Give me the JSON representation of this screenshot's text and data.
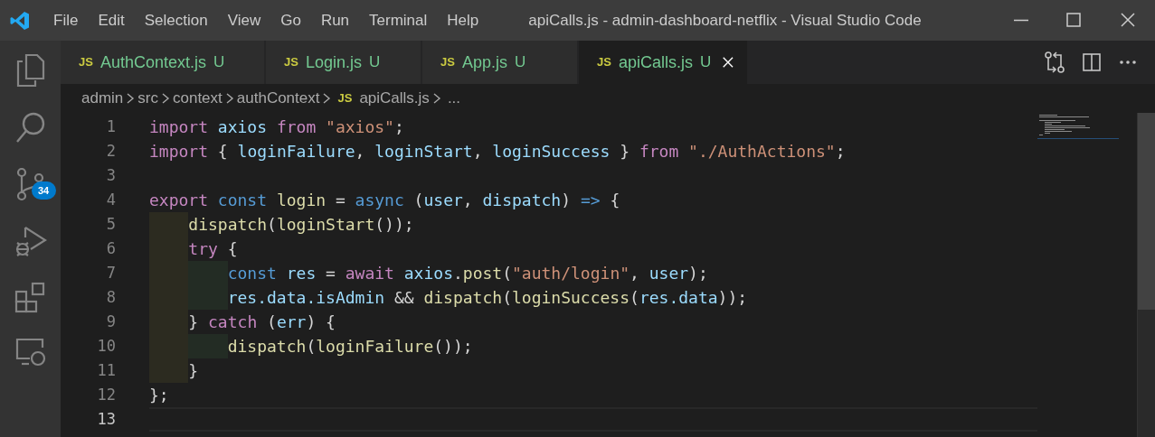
{
  "menu": [
    "File",
    "Edit",
    "Selection",
    "View",
    "Go",
    "Run",
    "Terminal",
    "Help"
  ],
  "window": {
    "title": "apiCalls.js - admin-dashboard-netflix - Visual Studio Code"
  },
  "activity_bar": {
    "source_control_badge": "34"
  },
  "tabs": [
    {
      "icon": "JS",
      "label": "AuthContext.js",
      "status": "U",
      "selected": false
    },
    {
      "icon": "JS",
      "label": "Login.js",
      "status": "U",
      "selected": false
    },
    {
      "icon": "JS",
      "label": "App.js",
      "status": "U",
      "selected": false
    },
    {
      "icon": "JS",
      "label": "apiCalls.js",
      "status": "U",
      "selected": true
    }
  ],
  "breadcrumbs": {
    "folders": [
      "admin",
      "src",
      "context",
      "authContext"
    ],
    "file_icon": "JS",
    "file": "apiCalls.js",
    "more": "..."
  },
  "lines": [
    {
      "number": "1",
      "current": false,
      "tokens": [
        {
          "kind": "keyword",
          "text": "import "
        },
        {
          "kind": "variable",
          "text": "axios "
        },
        {
          "kind": "keyword",
          "text": "from "
        },
        {
          "kind": "string",
          "text": "\"axios\""
        },
        {
          "kind": "plain",
          "text": ";"
        }
      ]
    },
    {
      "number": "2",
      "current": false,
      "tokens": [
        {
          "kind": "keyword",
          "text": "import"
        },
        {
          "kind": "plain",
          "text": " { "
        },
        {
          "kind": "variable",
          "text": "loginFailure"
        },
        {
          "kind": "plain",
          "text": ", "
        },
        {
          "kind": "variable",
          "text": "loginStart"
        },
        {
          "kind": "plain",
          "text": ", "
        },
        {
          "kind": "variable",
          "text": "loginSuccess"
        },
        {
          "kind": "plain",
          "text": " } "
        },
        {
          "kind": "keyword",
          "text": "from "
        },
        {
          "kind": "string",
          "text": "\"./AuthActions\""
        },
        {
          "kind": "plain",
          "text": ";"
        }
      ]
    },
    {
      "number": "3",
      "current": false
    },
    {
      "number": "4",
      "current": false,
      "tokens": [
        {
          "kind": "keyword",
          "text": "export "
        },
        {
          "kind": "storage",
          "text": "const "
        },
        {
          "kind": "function",
          "text": "login"
        },
        {
          "kind": "plain",
          "text": " = "
        },
        {
          "kind": "storage",
          "text": "async"
        },
        {
          "kind": "plain",
          "text": " ("
        },
        {
          "kind": "variable",
          "text": "user"
        },
        {
          "kind": "plain",
          "text": ", "
        },
        {
          "kind": "variable",
          "text": "dispatch"
        },
        {
          "kind": "plain",
          "text": ") "
        },
        {
          "kind": "storage",
          "text": "=>"
        },
        {
          "kind": "plain",
          "text": " {"
        }
      ]
    },
    {
      "number": "5",
      "current": false,
      "tokens": [
        {
          "kind": "indent1"
        },
        {
          "kind": "function",
          "text": "dispatch"
        },
        {
          "kind": "plain",
          "text": "("
        },
        {
          "kind": "function",
          "text": "loginStart"
        },
        {
          "kind": "plain",
          "text": "());"
        }
      ]
    },
    {
      "number": "6",
      "current": false,
      "tokens": [
        {
          "kind": "indent1"
        },
        {
          "kind": "keyword",
          "text": "try"
        },
        {
          "kind": "plain",
          "text": " {"
        }
      ]
    },
    {
      "number": "7",
      "current": false,
      "tokens": [
        {
          "kind": "indent1"
        },
        {
          "kind": "indent2"
        },
        {
          "kind": "storage",
          "text": "const "
        },
        {
          "kind": "variable",
          "text": "res"
        },
        {
          "kind": "plain",
          "text": " = "
        },
        {
          "kind": "keyword",
          "text": "await "
        },
        {
          "kind": "variable",
          "text": "axios"
        },
        {
          "kind": "plain",
          "text": "."
        },
        {
          "kind": "function",
          "text": "post"
        },
        {
          "kind": "plain",
          "text": "("
        },
        {
          "kind": "string",
          "text": "\"auth/login\""
        },
        {
          "kind": "plain",
          "text": ", "
        },
        {
          "kind": "variable",
          "text": "user"
        },
        {
          "kind": "plain",
          "text": ");"
        }
      ]
    },
    {
      "number": "8",
      "current": false,
      "tokens": [
        {
          "kind": "indent1"
        },
        {
          "kind": "indent2"
        },
        {
          "kind": "variable",
          "text": "res.data.isAdmin"
        },
        {
          "kind": "plain",
          "text": " && "
        },
        {
          "kind": "function",
          "text": "dispatch"
        },
        {
          "kind": "plain",
          "text": "("
        },
        {
          "kind": "function",
          "text": "loginSuccess"
        },
        {
          "kind": "plain",
          "text": "("
        },
        {
          "kind": "variable",
          "text": "res.data"
        },
        {
          "kind": "plain",
          "text": "));"
        }
      ]
    },
    {
      "number": "9",
      "current": false,
      "tokens": [
        {
          "kind": "indent1"
        },
        {
          "kind": "plain",
          "text": "} "
        },
        {
          "kind": "keyword",
          "text": "catch"
        },
        {
          "kind": "plain",
          "text": " ("
        },
        {
          "kind": "variable",
          "text": "err"
        },
        {
          "kind": "plain",
          "text": ") {"
        }
      ]
    },
    {
      "number": "10",
      "current": false,
      "tokens": [
        {
          "kind": "indent1"
        },
        {
          "kind": "indent2"
        },
        {
          "kind": "function",
          "text": "dispatch"
        },
        {
          "kind": "plain",
          "text": "("
        },
        {
          "kind": "function",
          "text": "loginFailure"
        },
        {
          "kind": "plain",
          "text": "());"
        }
      ]
    },
    {
      "number": "11",
      "current": false,
      "tokens": [
        {
          "kind": "indent1"
        },
        {
          "kind": "plain",
          "text": "}"
        }
      ]
    },
    {
      "number": "12",
      "current": false,
      "tokens": [
        {
          "kind": "plain",
          "text": "};"
        }
      ]
    },
    {
      "number": "13",
      "current": true
    }
  ]
}
